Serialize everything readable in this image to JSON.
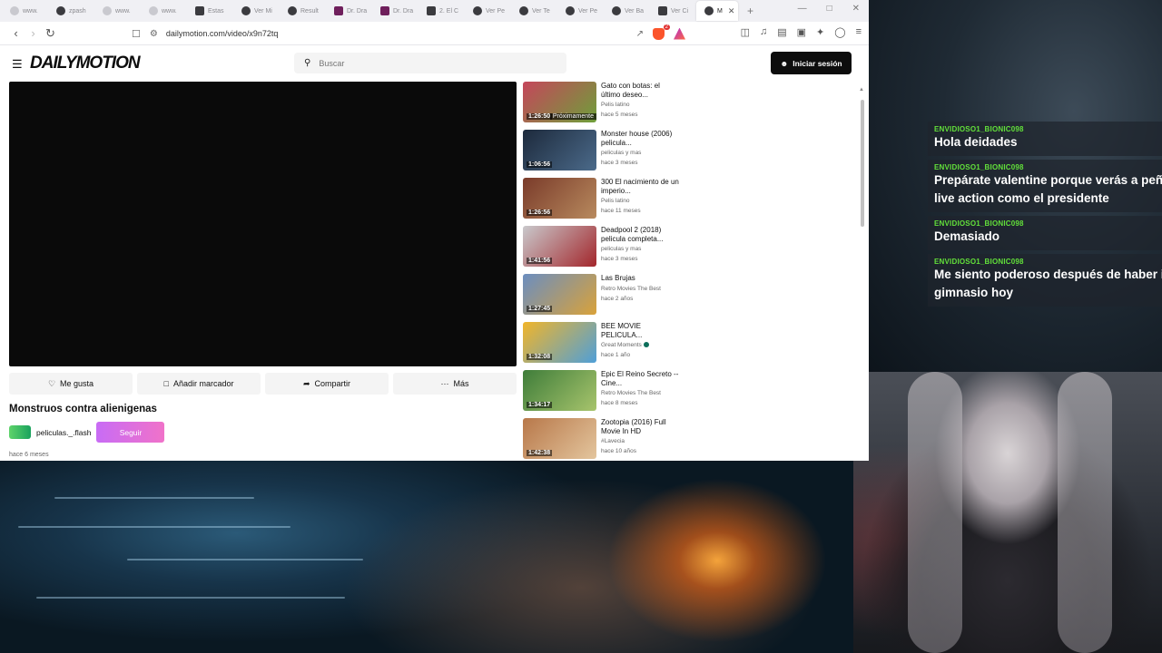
{
  "browser": {
    "tabs": [
      {
        "label": "www.",
        "icon": "globe-icon"
      },
      {
        "label": "zpash",
        "icon": "site-icon"
      },
      {
        "label": "www.",
        "icon": "globe-icon"
      },
      {
        "label": "www.",
        "icon": "globe-icon"
      },
      {
        "label": "Estas",
        "icon": "p-icon"
      },
      {
        "label": "Ver Mi",
        "icon": "a-icon"
      },
      {
        "label": "Result",
        "icon": "a-icon"
      },
      {
        "label": "Dr. Dra",
        "icon": "d-icon"
      },
      {
        "label": "Dr. Dra",
        "icon": "d-icon"
      },
      {
        "label": "2. El C",
        "icon": "doc-icon"
      },
      {
        "label": "Ver Pe",
        "icon": "a-icon"
      },
      {
        "label": "Ver Te",
        "icon": "a-icon"
      },
      {
        "label": "Ver Pe",
        "icon": "a-icon"
      },
      {
        "label": "Ver Ba",
        "icon": "a-icon"
      },
      {
        "label": "Ver Ci",
        "icon": "p-icon"
      },
      {
        "label": "M",
        "icon": "dailymotion-icon",
        "active": true
      }
    ],
    "url": "dailymotion.com/video/x9n72tq",
    "brave_badge": "2"
  },
  "header": {
    "logo": "DAILYMOTION",
    "search_placeholder": "Buscar",
    "login_label": "Iniciar sesión"
  },
  "video": {
    "actions": {
      "like": "Me gusta",
      "bookmark": "Añadir marcador",
      "share": "Compartir",
      "more": "Más"
    },
    "title": "Monstruos contra alienigenas",
    "channel": "peliculas._.flash",
    "follow_label": "Seguir",
    "posted": "hace 6 meses"
  },
  "recommendations": [
    {
      "title": "Gato con botas: el último deseo...",
      "owner": "Pelis latino",
      "date": "hace 5 meses",
      "duration": "1:26:50",
      "next": "Próximamente",
      "colors": [
        "#c5465b",
        "#6e9f3a"
      ]
    },
    {
      "title": "Monster house (2006) pelicula...",
      "owner": "peliculas y mas",
      "date": "hace 3 meses",
      "duration": "1:06:56",
      "colors": [
        "#1d2a3c",
        "#4b6a8a"
      ]
    },
    {
      "title": "300 El nacimiento de un imperio...",
      "owner": "Pelis latino",
      "date": "hace 11 meses",
      "duration": "1:26:56",
      "colors": [
        "#7a3b2a",
        "#b88a5e"
      ]
    },
    {
      "title": "Deadpool 2 (2018) pelicula completa...",
      "owner": "peliculas y mas",
      "date": "hace 3 meses",
      "duration": "1:41:56",
      "colors": [
        "#c9c9cc",
        "#a3262b"
      ]
    },
    {
      "title": "Las Brujas",
      "owner": "Retro Movies The Best",
      "date": "hace 2 años",
      "duration": "1:27:45",
      "colors": [
        "#6b8ec0",
        "#d9a23a"
      ]
    },
    {
      "title": "BEE MOVIE PELICULA...",
      "owner": "Great Moments",
      "owner_verified": true,
      "date": "hace 1 año",
      "duration": "1:32:08",
      "colors": [
        "#f1b52a",
        "#4f9fd8"
      ]
    },
    {
      "title": "Epic El Reino Secreto -- Cine...",
      "owner": "Retro Movies The Best",
      "date": "hace 8 meses",
      "duration": "1:34:17",
      "colors": [
        "#3f7d3a",
        "#a7c46c"
      ]
    },
    {
      "title": "Zootopia (2016) Full Movie In HD",
      "owner": "#Lavecia",
      "date": "hace 10 años",
      "duration": "1:42:38",
      "colors": [
        "#b8784a",
        "#e3c59d"
      ]
    }
  ],
  "chat": [
    {
      "user": "ENVIDIOSO1_BIONIC098",
      "lines": [
        "Hola deidades"
      ]
    },
    {
      "user": "ENVIDIOSO1_BIONIC098",
      "lines": [
        "Prepárate valentine porque verás a peñ",
        "live action como el presidente"
      ]
    },
    {
      "user": "ENVIDIOSO1_BIONIC098",
      "lines": [
        "Demasiado"
      ]
    },
    {
      "user": "ENVIDIOSO1_BIONIC098",
      "lines": [
        "Me siento poderoso después de haber id",
        "gimnasio hoy"
      ]
    }
  ]
}
